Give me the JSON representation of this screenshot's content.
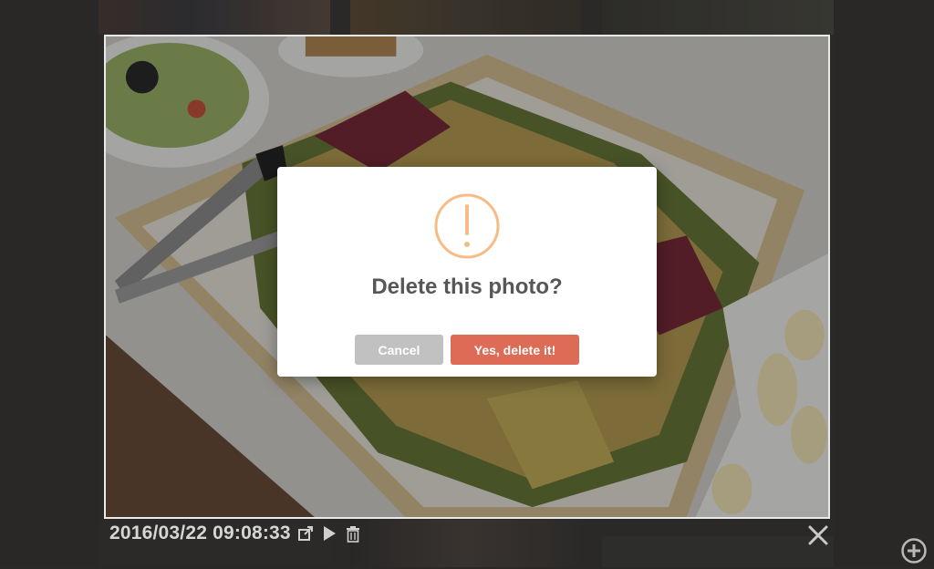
{
  "photo": {
    "timestamp": "2016/03/22 09:08:33"
  },
  "dialog": {
    "title": "Delete this photo?",
    "cancel_label": "Cancel",
    "confirm_label": "Yes, delete it!",
    "icon": "exclamation-circle-icon",
    "accent_color": "#f8bb86",
    "confirm_color": "#dd6b55",
    "cancel_color": "#c1c1c1"
  },
  "toolbar": {
    "icons": [
      "external-link-icon",
      "play-icon",
      "trash-icon"
    ]
  },
  "controls": {
    "close_icon": "close-icon",
    "add_icon": "add-circle-icon"
  }
}
